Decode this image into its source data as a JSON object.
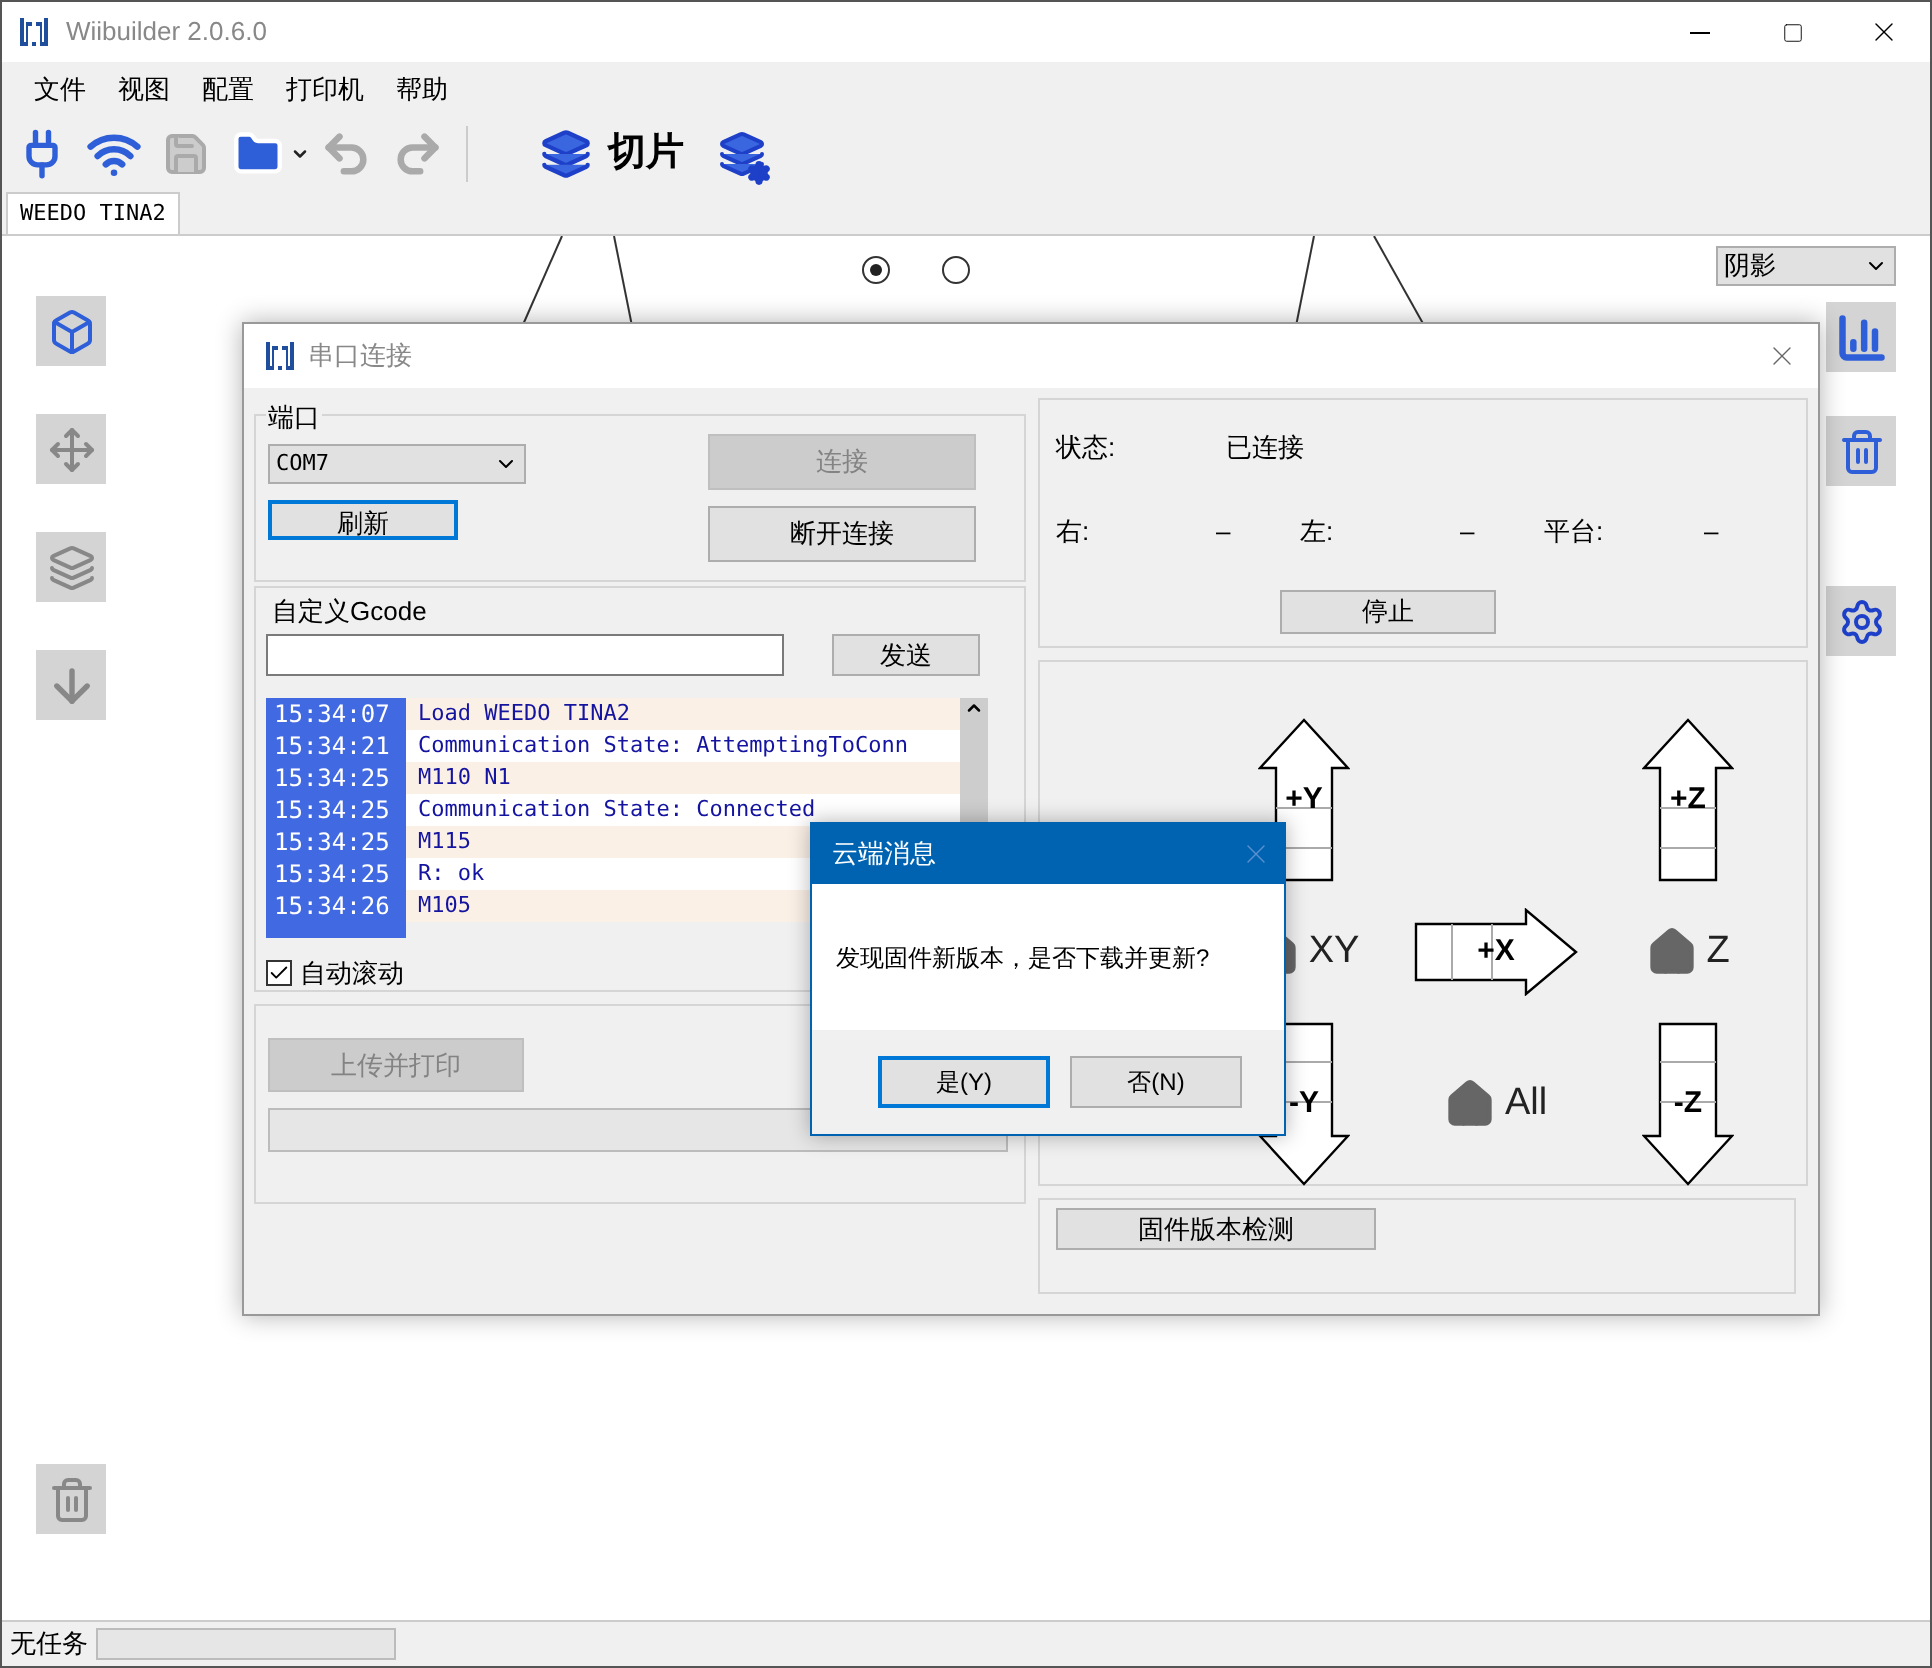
{
  "window": {
    "title": "Wiibuilder 2.0.6.0"
  },
  "menu": [
    "文件",
    "视图",
    "配置",
    "打印机",
    "帮助"
  ],
  "toolbar": {
    "slice_label": "切片"
  },
  "tabs": [
    {
      "label": "WEEDO TINA2",
      "selected": true
    }
  ],
  "view_radios": [
    {
      "selected": true
    },
    {
      "selected": false
    }
  ],
  "render_mode": {
    "value": "阴影"
  },
  "serial_dialog": {
    "title": "串口连接",
    "port_label": "端口",
    "port": "COM7",
    "refresh": "刷新",
    "connect": {
      "label": "连接",
      "disabled": true
    },
    "disconnect": {
      "label": "断开连接",
      "disabled": false
    },
    "gcode_label": "自定义Gcode",
    "send": "发送",
    "log": [
      {
        "time": "15:34:07",
        "message": "Load WEEDO TINA2"
      },
      {
        "time": "15:34:21",
        "message": "Communication State: AttemptingToConn"
      },
      {
        "time": "15:34:25",
        "message": "M110 N1"
      },
      {
        "time": "15:34:25",
        "message": "Communication State: Connected"
      },
      {
        "time": "15:34:25",
        "message": "M115"
      },
      {
        "time": "15:34:25",
        "message": "R: ok"
      },
      {
        "time": "15:34:26",
        "message": "M105"
      }
    ],
    "auto_scroll": {
      "label": "自动滚动",
      "checked": true
    },
    "upload": {
      "label": "上传并打印",
      "disabled": true
    },
    "upload_progress": {
      "level": 0
    },
    "status": {
      "label": "状态:",
      "value": "已连接"
    },
    "temps": [
      {
        "label": "右:",
        "value": "–"
      },
      {
        "label": "左:",
        "value": "–"
      },
      {
        "label": "平台:",
        "value": "–"
      }
    ],
    "stop": "停止",
    "jog": [
      {
        "kind": "up",
        "label": "+Y"
      },
      {
        "kind": "empty"
      },
      {
        "kind": "up",
        "label": "+Z"
      },
      {
        "kind": "home",
        "label": "XY"
      },
      {
        "kind": "right",
        "label": "+X"
      },
      {
        "kind": "home",
        "label": "Z"
      },
      {
        "kind": "down",
        "label": "-Y"
      },
      {
        "kind": "home",
        "label": "All"
      },
      {
        "kind": "down",
        "label": "-Z"
      }
    ],
    "firmware_check": "固件版本检测"
  },
  "message_dialog": {
    "title": "云端消息",
    "message": "发现固件新版本，是否下载并更新?",
    "buttons": [
      {
        "label": "是(Y)",
        "selected": true
      },
      {
        "label": "否(N)",
        "selected": false
      }
    ]
  },
  "status_bar": {
    "text": "无任务",
    "level": 0
  }
}
